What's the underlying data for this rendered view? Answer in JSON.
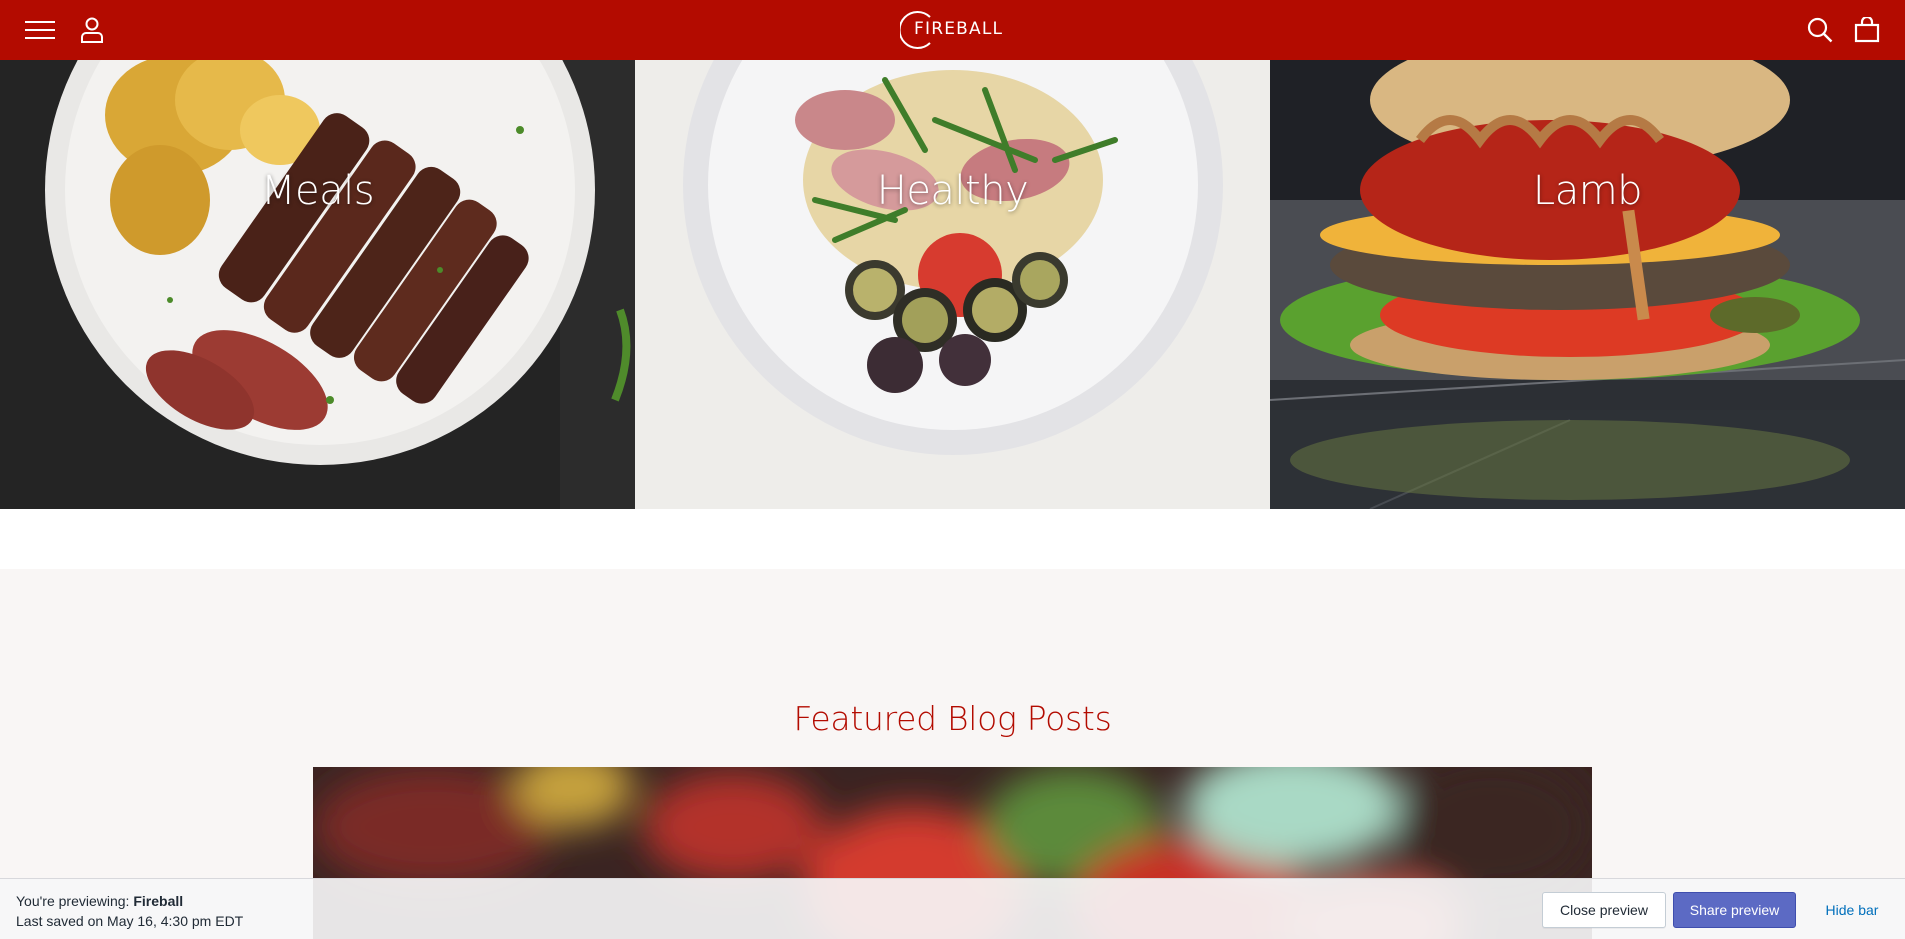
{
  "header": {
    "brand": "FIREBALL",
    "background_color": "#b30b00",
    "icons": [
      "menu-icon",
      "account-icon",
      "search-icon",
      "cart-icon"
    ]
  },
  "collections": [
    {
      "title": "Meals"
    },
    {
      "title": "Healthy"
    },
    {
      "title": "Lamb"
    }
  ],
  "blog": {
    "heading": "Featured Blog Posts",
    "heading_color": "#b30b00"
  },
  "preview_bar": {
    "previewing_prefix": "You're previewing: ",
    "theme_name": "Fireball",
    "last_saved": "Last saved on May 16, 4:30 pm EDT",
    "close_label": "Close preview",
    "share_label": "Share preview",
    "hide_label": "Hide bar",
    "share_color": "#5c6ac4",
    "link_color": "#006fbb"
  }
}
